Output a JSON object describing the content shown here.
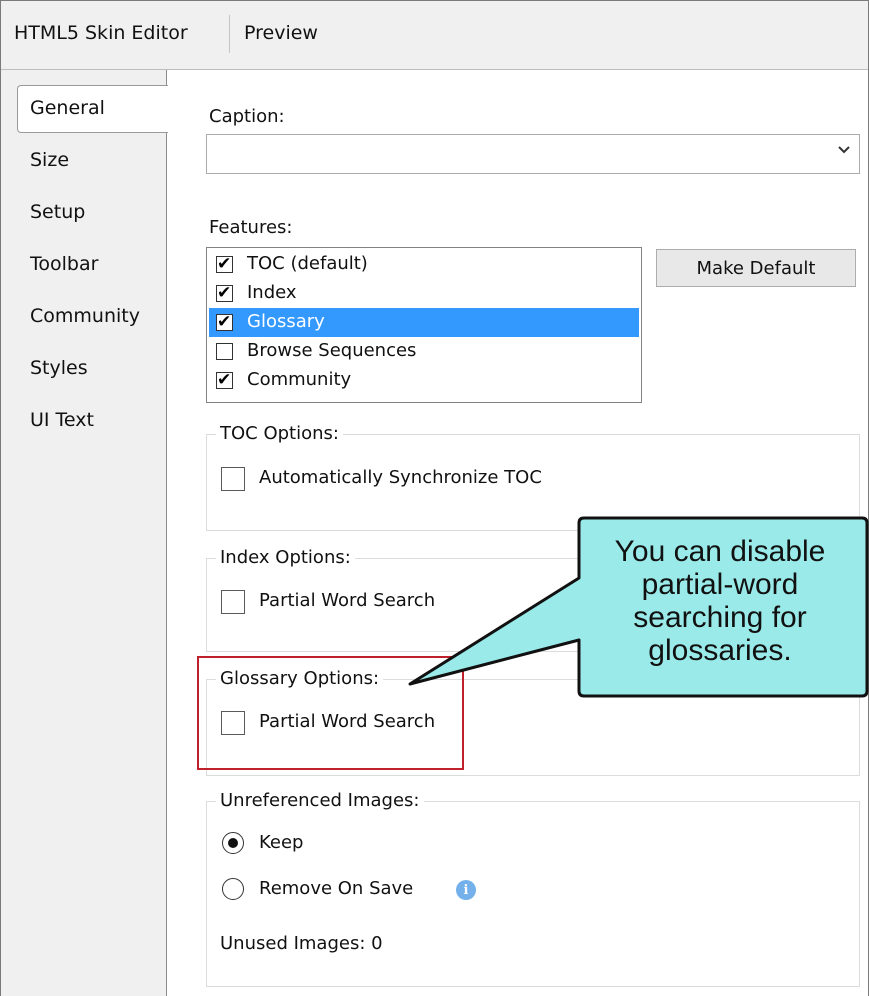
{
  "header": {
    "tabs": [
      {
        "label": "HTML5 Skin Editor"
      },
      {
        "label": "Preview"
      }
    ]
  },
  "sidebar": {
    "items": [
      {
        "label": "General",
        "active": true
      },
      {
        "label": "Size"
      },
      {
        "label": "Setup"
      },
      {
        "label": "Toolbar"
      },
      {
        "label": "Community"
      },
      {
        "label": "Styles"
      },
      {
        "label": "UI Text"
      }
    ]
  },
  "caption": {
    "label": "Caption:",
    "value": ""
  },
  "features": {
    "label": "Features:",
    "items": [
      {
        "label": "TOC (default)",
        "checked": true,
        "selected": false
      },
      {
        "label": "Index",
        "checked": true,
        "selected": false
      },
      {
        "label": "Glossary",
        "checked": true,
        "selected": true
      },
      {
        "label": "Browse Sequences",
        "checked": false,
        "selected": false
      },
      {
        "label": "Community",
        "checked": true,
        "selected": false
      }
    ],
    "make_default_label": "Make Default"
  },
  "toc_options": {
    "title": "TOC Options:",
    "checkbox_label": "Automatically Synchronize TOC",
    "checked": false
  },
  "index_options": {
    "title": "Index Options:",
    "checkbox_label": "Partial Word Search",
    "checked": false
  },
  "glossary_options": {
    "title": "Glossary Options:",
    "checkbox_label": "Partial Word Search",
    "checked": false
  },
  "unreferenced_images": {
    "title": "Unreferenced Images:",
    "options": [
      {
        "label": "Keep",
        "selected": true
      },
      {
        "label": "Remove On Save",
        "selected": false
      }
    ],
    "unused_label": "Unused Images: 0"
  },
  "callout": {
    "lines": [
      "You can disable",
      "partial-word",
      "searching for",
      "glossaries."
    ],
    "fill_color": "#9aeaea",
    "highlight_color": "#c0202a"
  },
  "icons": {
    "info": "info-icon",
    "dropdown": "chevron-down-icon",
    "check": "checkmark-icon"
  }
}
